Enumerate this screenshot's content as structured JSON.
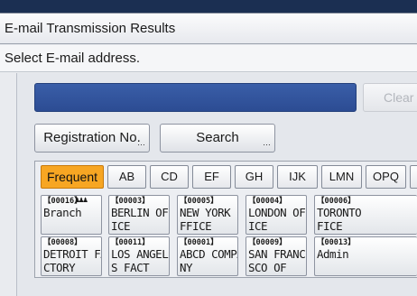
{
  "window": {
    "title": "E-mail Transmission Results"
  },
  "prompt": "Select E-mail address.",
  "address": {
    "value": "",
    "clear_label": "Clear"
  },
  "buttons": {
    "registration": "Registration No.",
    "search": "Search"
  },
  "tabs": [
    "Frequent",
    "AB",
    "CD",
    "EF",
    "GH",
    "IJK",
    "LMN",
    "OPQ",
    ""
  ],
  "active_tab": "Frequent",
  "group_icon": "group-icon",
  "entries": [
    {
      "number": "【00016】",
      "name_line1": "Branch",
      "name_line2": "",
      "group": true
    },
    {
      "number": "【00003】",
      "name_line1": "BERLIN OFF",
      "name_line2": "ICE"
    },
    {
      "number": "【00005】",
      "name_line1": "NEW YORK O",
      "name_line2": "FFICE"
    },
    {
      "number": "【00004】",
      "name_line1": "LONDON OFF",
      "name_line2": "ICE"
    },
    {
      "number": "【00006】",
      "name_line1": "TORONTO",
      "name_line2": "FICE"
    },
    {
      "number": "【00008】",
      "name_line1": "DETROIT FA",
      "name_line2": "CTORY"
    },
    {
      "number": "【00011】",
      "name_line1": "LOS ANGELE",
      "name_line2": "S FACT"
    },
    {
      "number": "【00001】",
      "name_line1": "ABCD COMPA",
      "name_line2": "NY"
    },
    {
      "number": "【00009】",
      "name_line1": "SAN FRANCI",
      "name_line2": "SCO OF"
    },
    {
      "number": "【00013】",
      "name_line1": "Admin",
      "name_line2": ""
    }
  ],
  "colors": {
    "accent": "#f7a623",
    "address_bar": "#2c4c93",
    "title_strip": "#1b2f52"
  }
}
